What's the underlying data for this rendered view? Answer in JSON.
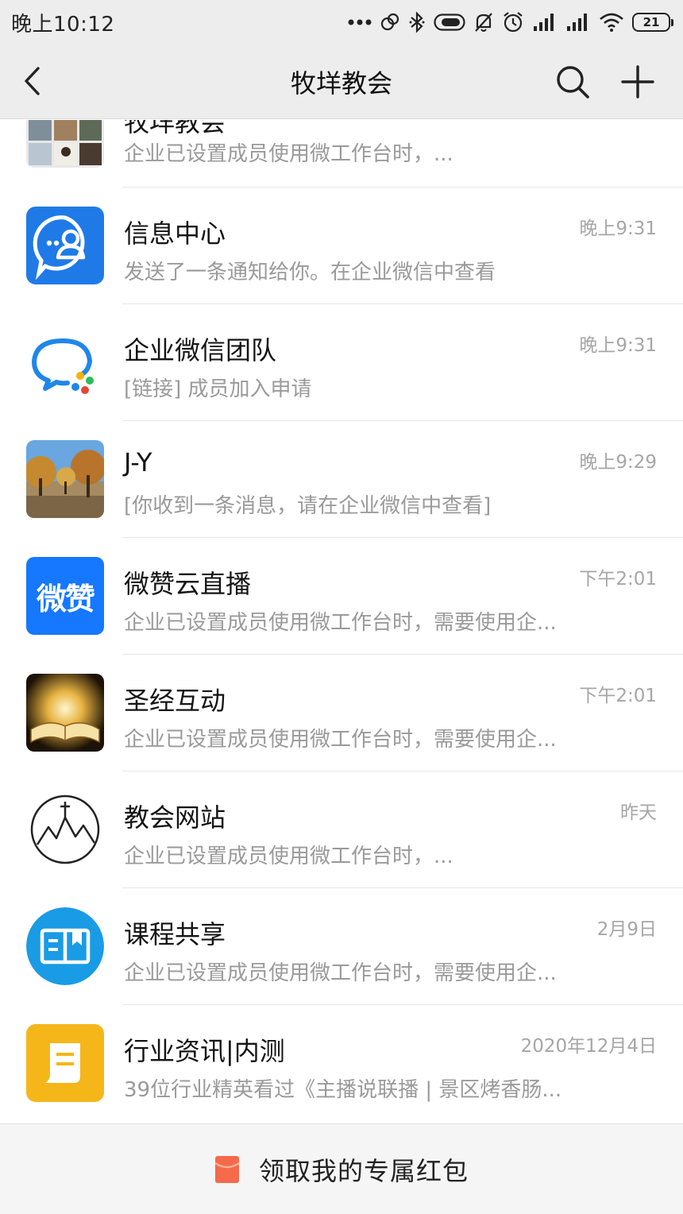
{
  "status_bar": {
    "time": "晚上10:12",
    "battery": "21",
    "icons": [
      "more-dots-icon",
      "sync-icon",
      "bluetooth-icon",
      "toggle-icon",
      "mute-icon",
      "alarm-icon",
      "signal-icon",
      "signal-icon",
      "wifi-icon",
      "battery-icon"
    ]
  },
  "header": {
    "title": "牧垟教会",
    "back_icon": "back-chevron-icon",
    "search_icon": "search-icon",
    "add_icon": "plus-icon"
  },
  "conversations": [
    {
      "title": "牧垟教会",
      "preview": "企业已设置成员使用微工作台时，...",
      "time": "",
      "avatar": "group-collage-avatar"
    },
    {
      "title": "信息中心",
      "preview": "发送了一条通知给你。在企业微信中查看",
      "time": "晚上9:31",
      "avatar": "info-center-avatar"
    },
    {
      "title": "企业微信团队",
      "preview": "[链接] 成员加入申请",
      "time": "晚上9:31",
      "avatar": "wecom-logo-avatar"
    },
    {
      "title": "J-Y",
      "preview": "[你收到一条消息，请在企业微信中查看]",
      "time": "晚上9:29",
      "avatar": "tree-photo-avatar"
    },
    {
      "title": "微赞云直播",
      "preview": "企业已设置成员使用微工作台时，需要使用企...",
      "time": "下午2:01",
      "avatar": "weizan-logo-avatar",
      "avatar_text": "微赞"
    },
    {
      "title": "圣经互动",
      "preview": "企业已设置成员使用微工作台时，需要使用企...",
      "time": "下午2:01",
      "avatar": "bible-photo-avatar"
    },
    {
      "title": "教会网站",
      "preview": "企业已设置成员使用微工作台时，...",
      "time": "昨天",
      "avatar": "church-logo-avatar"
    },
    {
      "title": "课程共享",
      "preview": "企业已设置成员使用微工作台时，需要使用企...",
      "time": "2月9日",
      "avatar": "book-icon-avatar"
    },
    {
      "title": "行业资讯|内测",
      "preview": "39位行业精英看过《主播说联播 | 景区烤香肠...",
      "time": "2020年12月4日",
      "avatar": "document-icon-avatar"
    }
  ],
  "banner": {
    "label": "领取我的专属红包",
    "icon": "red-envelope-icon"
  },
  "colors": {
    "header_bg": "#ededed",
    "info_blue": "#1f7ae8",
    "weizan_blue": "#1677ff",
    "course_blue": "#1a9be6",
    "news_yellow": "#f5b619",
    "red_envelope": "#f46a4a"
  }
}
